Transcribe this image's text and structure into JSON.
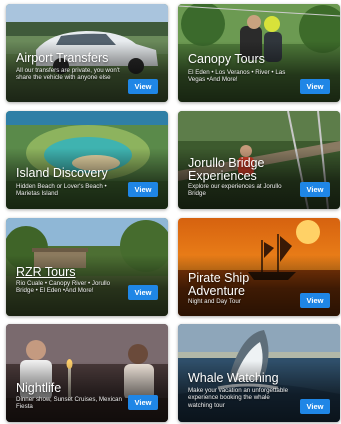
{
  "cards": [
    {
      "title": "Airport Transfers",
      "desc": "All our transfers are private, you won't share the vehicle with anyone else",
      "button": "View"
    },
    {
      "title": "Canopy Tours",
      "desc": "El Eden • Los Veranos • River • Las Vegas •And More!",
      "button": "View"
    },
    {
      "title": "Island Discovery",
      "desc": "Hidden Beach or Lover's Beach • Marietas Island",
      "button": "View"
    },
    {
      "title": "Jorullo Bridge Experiences",
      "desc": "Explore our experiences at Jorullo Bridge",
      "button": "View"
    },
    {
      "title": "RZR Tours",
      "desc": "Rio Cuale • Canopy River • Jorullo Bridge • El Eden •And More!",
      "button": "View"
    },
    {
      "title": "Pirate Ship Adventure",
      "desc": "Night and Day Tour",
      "button": "View"
    },
    {
      "title": "Nightlife",
      "desc": "Dinner show, Sunset Cruises, Mexican Fiesta",
      "button": "View"
    },
    {
      "title": "Whale Watching",
      "desc": "Make your vacation an unforgettable experience booking the whale watching tour",
      "button": "View"
    }
  ],
  "icons": {
    "airport": "car-photo",
    "canopy": "zipline-photo",
    "island": "hidden-beach-photo",
    "jorullo": "bridge-photo",
    "rzr": "jungle-photo",
    "pirate": "pirate-ship-photo",
    "nightlife": "dinner-photo",
    "whale": "whale-photo"
  },
  "colors": {
    "button": "#1f86e6",
    "text": "#ffffff"
  }
}
